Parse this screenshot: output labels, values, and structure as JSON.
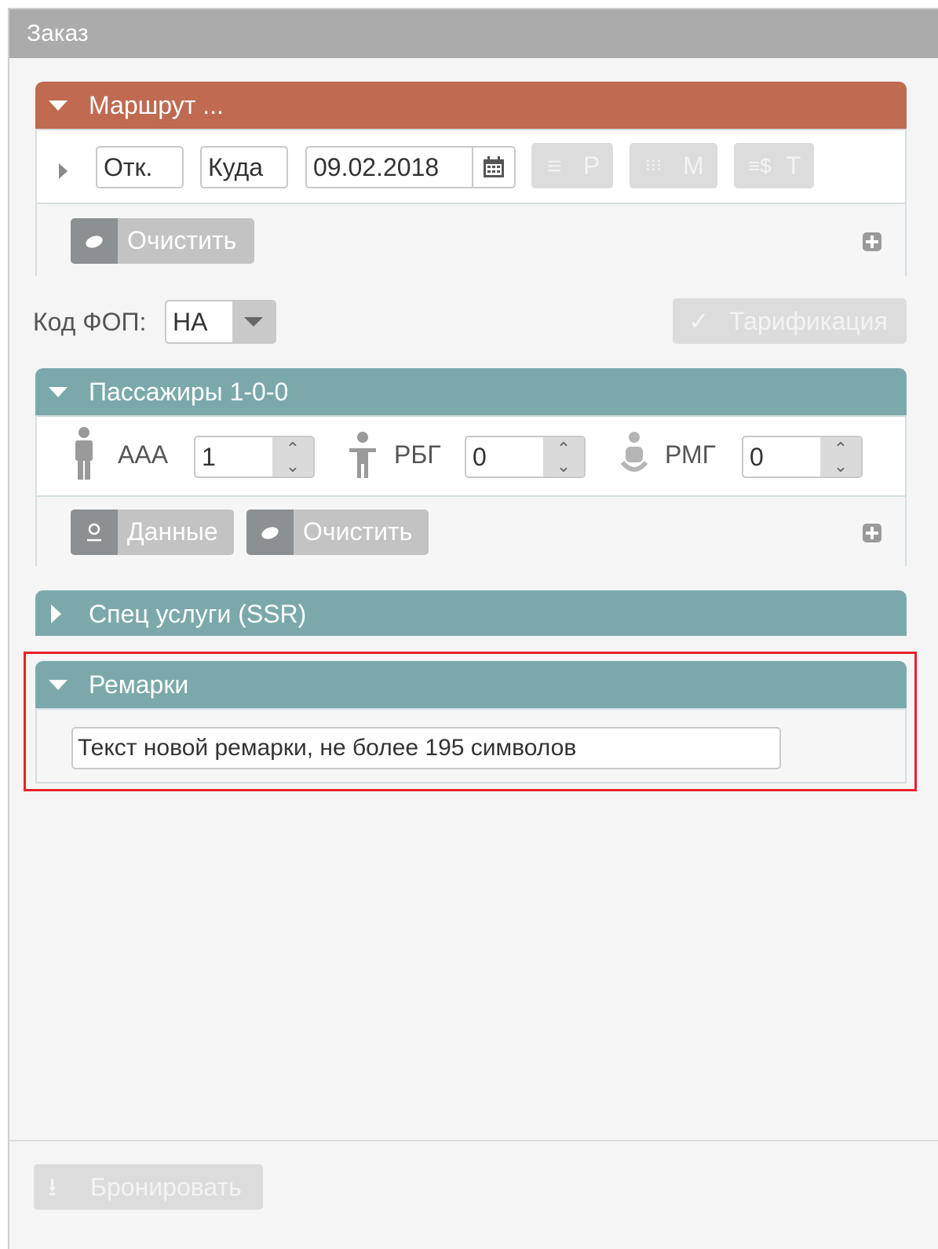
{
  "panel": {
    "title": "Заказ"
  },
  "route": {
    "header": "Маршрут ...",
    "from": "Отк.",
    "to": "Куда",
    "date": "09.02.2018",
    "btn_r": "Р",
    "btn_m": "М",
    "btn_t": "Т",
    "clear": "Очистить"
  },
  "fop": {
    "label": "Код ФОП:",
    "value": "НА",
    "tariff": "Тарификация"
  },
  "passengers": {
    "header": "Пассажиры 1-0-0",
    "types": [
      {
        "label": "ААА",
        "value": "1"
      },
      {
        "label": "РБГ",
        "value": "0"
      },
      {
        "label": "РМГ",
        "value": "0"
      }
    ],
    "data_btn": "Данные",
    "clear": "Очистить"
  },
  "ssr": {
    "header": "Спец услуги (SSR)"
  },
  "remarks": {
    "header": "Ремарки",
    "placeholder": "Текст новой ремарки, не более 195 символов"
  },
  "footer": {
    "book": "Бронировать"
  },
  "colors": {
    "route": "#bf6a51",
    "section": "#7ba9ab",
    "highlight": "#e8202a"
  }
}
